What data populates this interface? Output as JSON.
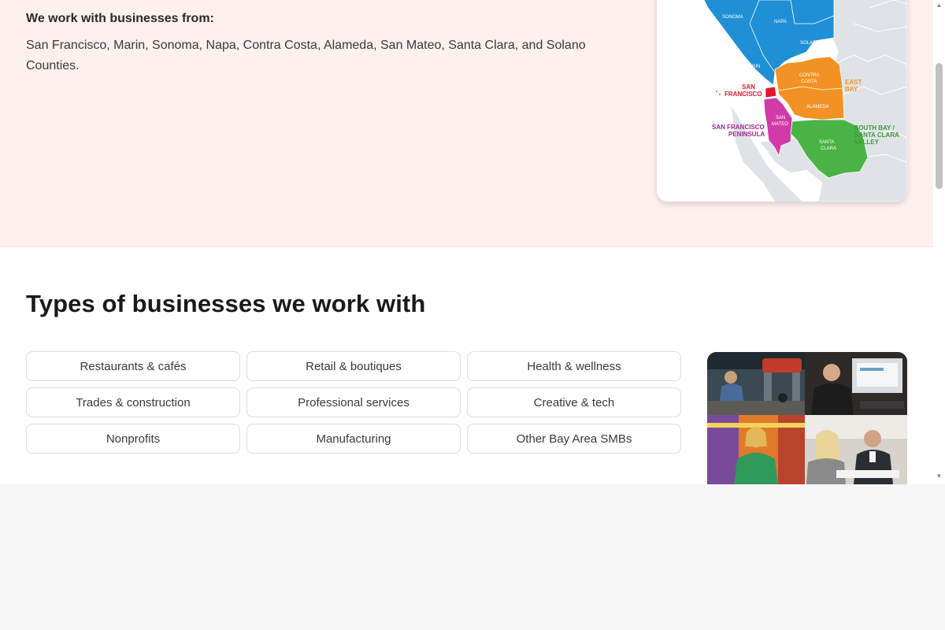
{
  "coverage": {
    "heading": "We work with businesses from:",
    "counties_text": "San Francisco, Marin, Sonoma, Napa, Contra Costa, Alameda, San Mateo, Santa Clara, and Solano Counties."
  },
  "map": {
    "labels": {
      "bay": "BAY",
      "sonoma": "SONOMA",
      "napa": "NAPA",
      "solano": "SOLANO",
      "marin": "MARIN",
      "contra_costa_1": "CONTRA",
      "contra_costa_2": "COSTA",
      "alameda": "ALAMEDA",
      "east_bay_1": "EAST",
      "east_bay_2": "BAY",
      "sf_1": "SAN",
      "sf_2": "FRANCISCO",
      "san_mateo_1": "SAN",
      "san_mateo_2": "MATEO",
      "peninsula_1": "SAN FRANCISCO",
      "peninsula_2": "PENINSULA",
      "santa_clara_1": "SANTA",
      "santa_clara_2": "CLARA",
      "south_bay_1": "SOUTH BAY /",
      "south_bay_2": "SANTA CLARA",
      "south_bay_3": "VALLEY"
    },
    "colors": {
      "north_bay": "#1f8fd6",
      "east_bay": "#f39224",
      "san_francisco": "#e0182a",
      "peninsula": "#d23aa8",
      "south_bay": "#4bb346",
      "land": "#dfe3e8",
      "water": "#ffffff"
    }
  },
  "types": {
    "title": "Types of businesses we work with",
    "items": [
      "Restaurants & cafés",
      "Retail & boutiques",
      "Health & wellness",
      "Trades & construction",
      "Professional services",
      "Creative & tech",
      "Nonprofits",
      "Manufacturing",
      "Other Bay Area SMBs"
    ]
  },
  "photos": [
    {
      "icon": "auto-mechanic-photo"
    },
    {
      "icon": "business-meeting-photo"
    },
    {
      "icon": "cafe-owner-photo"
    },
    {
      "icon": "consultation-photo"
    }
  ]
}
